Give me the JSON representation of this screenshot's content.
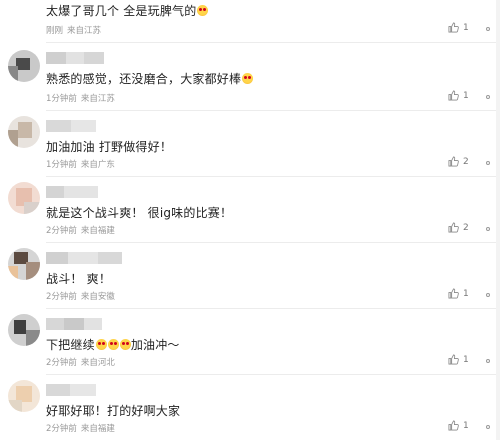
{
  "comments": [
    {
      "text": "太爆了哥几个 全是玩脾气的",
      "emoji": [
        "heart-eyes"
      ],
      "time": "刚刚",
      "location": "来自江苏",
      "likes": "1"
    },
    {
      "text": "熟悉的感觉，还没磨合，大家都好棒",
      "emoji": [
        "blush"
      ],
      "time": "1分钟前",
      "location": "来自江苏",
      "likes": "1"
    },
    {
      "text": "加油加油 打野做得好！",
      "emoji": [],
      "time": "1分钟前",
      "location": "来自广东",
      "likes": "2"
    },
    {
      "text": "就是这个战斗爽！ 很ig味的比赛！",
      "emoji": [],
      "time": "2分钟前",
      "location": "来自福建",
      "likes": "2"
    },
    {
      "text": "战斗！ 爽！",
      "emoji": [],
      "time": "2分钟前",
      "location": "来自安徽",
      "likes": "1"
    },
    {
      "text_before": "下把继续",
      "text_after": "加油冲～",
      "emoji": [
        "heart-eyes",
        "heart-eyes",
        "heart-eyes"
      ],
      "time": "2分钟前",
      "location": "来自河北",
      "likes": "1"
    },
    {
      "text": "好耶好耶！打的好啊大家",
      "emoji": [],
      "time": "2分钟前",
      "location": "来自福建",
      "likes": "1"
    }
  ],
  "icons": {
    "like": "thumbs-up-icon",
    "more": "more-options-icon"
  },
  "colors": {
    "meta": "#9a9a9a",
    "text": "#222222",
    "divider": "#ececec"
  }
}
